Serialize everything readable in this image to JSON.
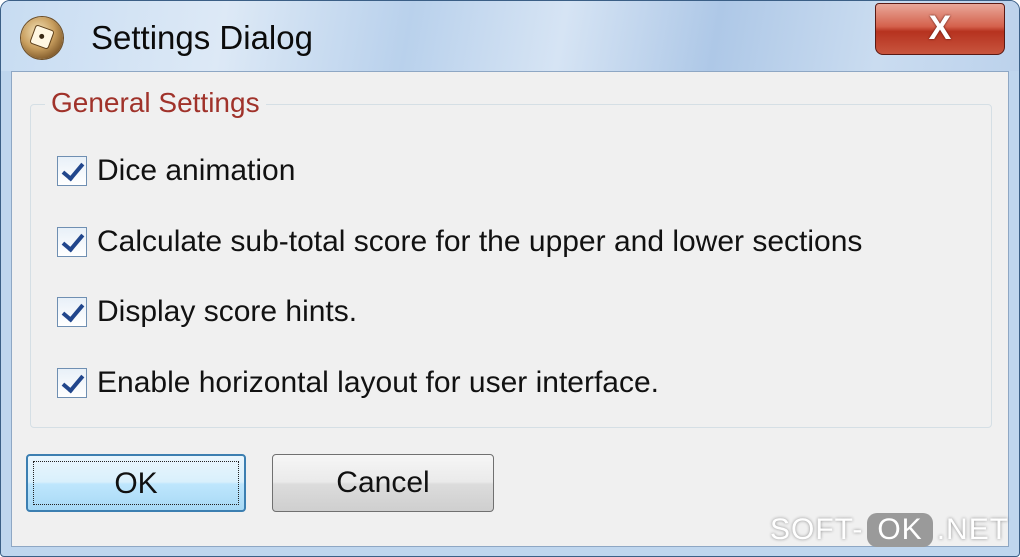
{
  "window": {
    "title": "Settings Dialog",
    "close_glyph": "X",
    "icon": "dice-app-icon"
  },
  "group": {
    "legend": "General Settings"
  },
  "options": [
    {
      "label": "Dice animation",
      "checked": true
    },
    {
      "label": "Calculate sub-total score for the upper and lower sections",
      "checked": true
    },
    {
      "label": "Display score hints.",
      "checked": true
    },
    {
      "label": "Enable horizontal layout for user interface.",
      "checked": true
    }
  ],
  "buttons": {
    "ok": "OK",
    "cancel": "Cancel"
  },
  "watermark": {
    "left": "SOFT-",
    "middle": "OK",
    "right": ".NET"
  },
  "colors": {
    "legend": "#a0322a",
    "check": "#21468c",
    "close": "#c8553e"
  }
}
